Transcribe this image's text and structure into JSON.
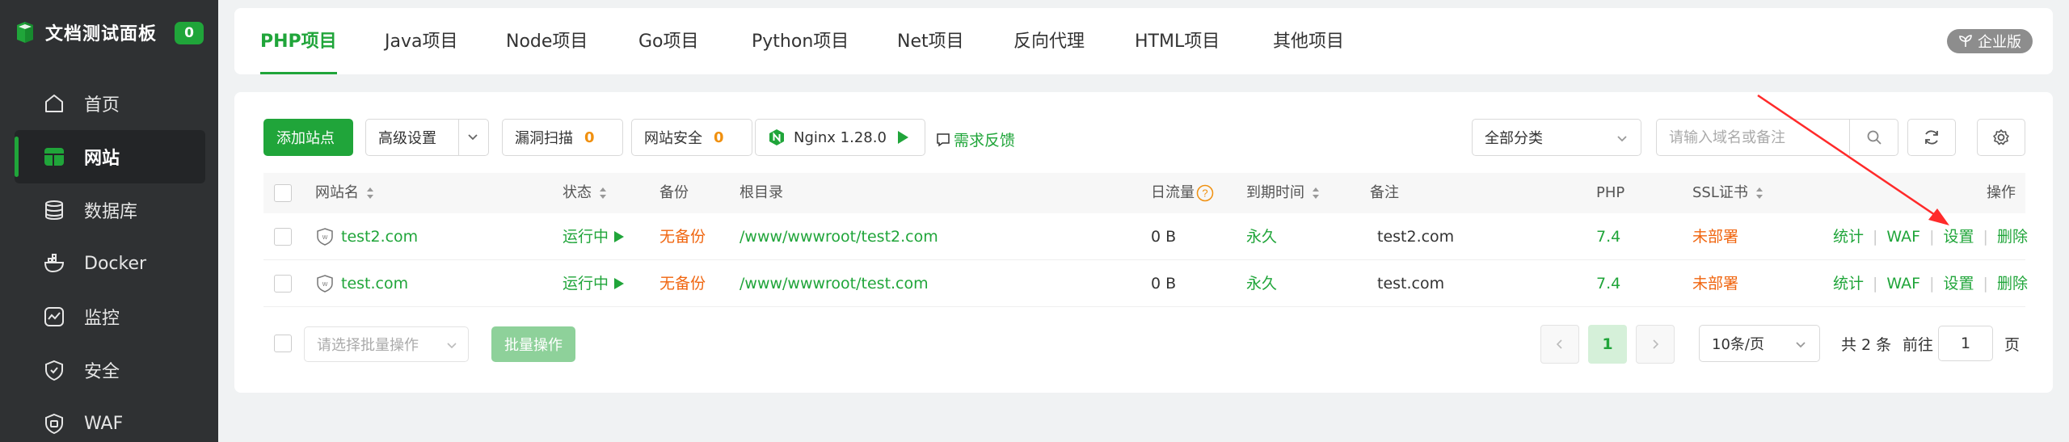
{
  "sidebar": {
    "title": "文档测试面板",
    "badge": "0",
    "items": [
      {
        "label": "首页",
        "icon": "home-icon"
      },
      {
        "label": "网站",
        "icon": "website-icon"
      },
      {
        "label": "数据库",
        "icon": "database-icon"
      },
      {
        "label": "Docker",
        "icon": "docker-icon"
      },
      {
        "label": "监控",
        "icon": "monitor-icon"
      },
      {
        "label": "安全",
        "icon": "shield-icon"
      },
      {
        "label": "WAF",
        "icon": "waf-icon"
      }
    ]
  },
  "tabs": [
    "PHP项目",
    "Java项目",
    "Node项目",
    "Go项目",
    "Python项目",
    "Net项目",
    "反向代理",
    "HTML项目",
    "其他项目"
  ],
  "enterprise_badge": "企业版",
  "toolbar": {
    "add_site": "添加站点",
    "advanced": "高级设置",
    "vuln_scan": "漏洞扫描",
    "vuln_count": "0",
    "site_security": "网站安全",
    "security_count": "0",
    "nginx": "Nginx 1.28.0",
    "feedback": "需求反馈",
    "category": "全部分类",
    "search_placeholder": "请输入域名或备注"
  },
  "table": {
    "headers": {
      "name": "网站名",
      "status": "状态",
      "backup": "备份",
      "root": "根目录",
      "traffic": "日流量",
      "expire": "到期时间",
      "remark": "备注",
      "php": "PHP",
      "ssl": "SSL证书",
      "ops": "操作"
    },
    "rows": [
      {
        "name": "test2.com",
        "status": "运行中",
        "backup": "无备份",
        "root": "/www/wwwroot/test2.com",
        "traffic": "0 B",
        "expire": "永久",
        "remark": "test2.com",
        "php": "7.4",
        "ssl": "未部署"
      },
      {
        "name": "test.com",
        "status": "运行中",
        "backup": "无备份",
        "root": "/www/wwwroot/test.com",
        "traffic": "0 B",
        "expire": "永久",
        "remark": "test.com",
        "php": "7.4",
        "ssl": "未部署"
      }
    ],
    "ops": [
      "统计",
      "WAF",
      "设置",
      "删除"
    ]
  },
  "footer": {
    "batch_placeholder": "请选择批量操作",
    "batch_button": "批量操作",
    "current_page": "1",
    "page_size": "10条/页",
    "total": "共 2 条",
    "goto_prefix": "前往",
    "goto_value": "1",
    "goto_suffix": "页"
  },
  "colors": {
    "brand": "#20a53a",
    "warning": "#f0650f",
    "annotation_arrow": "#ff2a2a"
  }
}
